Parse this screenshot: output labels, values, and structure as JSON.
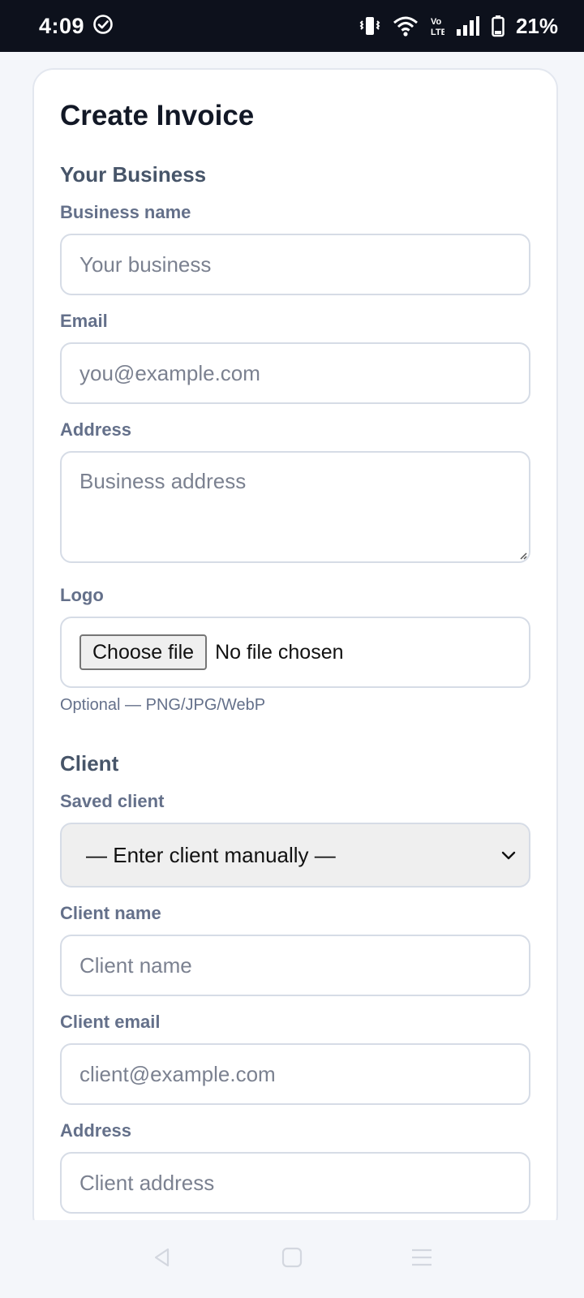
{
  "status_bar": {
    "time": "4:09",
    "battery_percent": "21%",
    "icons": [
      "check-circle-icon",
      "vibrate-icon",
      "wifi-icon",
      "volte-icon",
      "signal-icon",
      "battery-icon"
    ]
  },
  "page": {
    "title": "Create Invoice"
  },
  "business_section": {
    "title": "Your Business",
    "business_name": {
      "label": "Business name",
      "placeholder": "Your business"
    },
    "email": {
      "label": "Email",
      "placeholder": "you@example.com"
    },
    "address": {
      "label": "Address",
      "placeholder": "Business address"
    },
    "logo": {
      "label": "Logo",
      "button_label": "Choose file",
      "status": "No file chosen",
      "helper": "Optional — PNG/JPG/WebP"
    }
  },
  "client_section": {
    "title": "Client",
    "saved_client": {
      "label": "Saved client",
      "selected": "— Enter client manually —"
    },
    "client_name": {
      "label": "Client name",
      "placeholder": "Client name"
    },
    "client_email": {
      "label": "Client email",
      "placeholder": "client@example.com"
    },
    "address": {
      "label": "Address",
      "placeholder": "Client address"
    }
  },
  "nav_bar": {
    "icons": [
      "back-icon",
      "home-icon",
      "recents-icon"
    ]
  },
  "colors": {
    "status_bar_bg": "#0d111c",
    "page_bg": "#f4f6fa",
    "title": "#121826",
    "section_title": "#475569",
    "label": "#64708a",
    "input_border": "#d6dce6"
  }
}
